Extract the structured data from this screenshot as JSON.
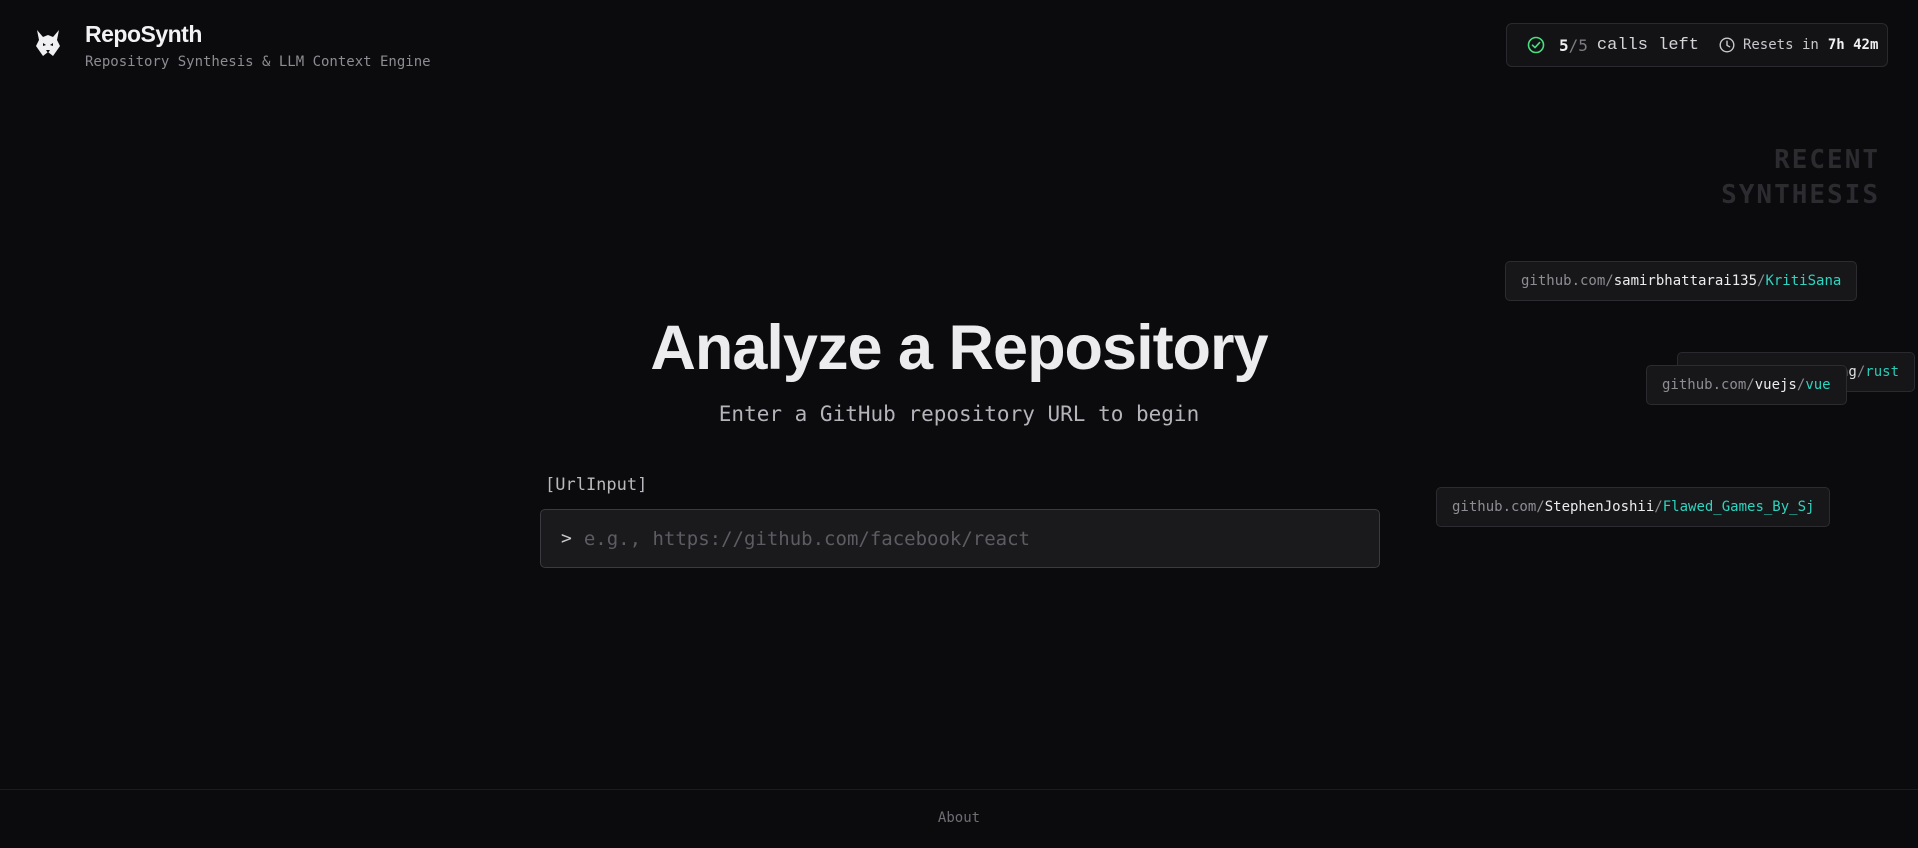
{
  "header": {
    "title": "RepoSynth",
    "subtitle": "Repository Synthesis & LLM Context Engine",
    "logo_icon": "wolf-logo-icon"
  },
  "quota": {
    "used": "5",
    "separator": "/",
    "total": "5",
    "label": "calls left",
    "resets_label": "Resets in",
    "resets_time": "7h 42m",
    "check_color": "#4ade80"
  },
  "recent": {
    "title": "RECENT SYNTHESIS",
    "items": [
      {
        "host": "github.com/",
        "owner": "samirbhattarai135",
        "slash": "/",
        "repo": "KritiSana"
      },
      {
        "host": "",
        "owner": "ng",
        "slash": "/",
        "repo": "rust"
      },
      {
        "host": "github.com/",
        "owner": "vuejs",
        "slash": "/",
        "repo": "vue"
      },
      {
        "host": "github.com/",
        "owner": "StephenJoshii",
        "slash": "/",
        "repo": "Flawed_Games_By_Sj"
      }
    ]
  },
  "main": {
    "title": "Analyze a Repository",
    "subtitle": "Enter a GitHub repository URL to begin",
    "input_label": "[UrlInput]",
    "prompt": ">",
    "input_placeholder": "e.g., https://github.com/facebook/react",
    "input_value": ""
  },
  "footer": {
    "about": "About"
  },
  "colors": {
    "background": "#0b0b0d",
    "accent": "#2dd4bf"
  }
}
